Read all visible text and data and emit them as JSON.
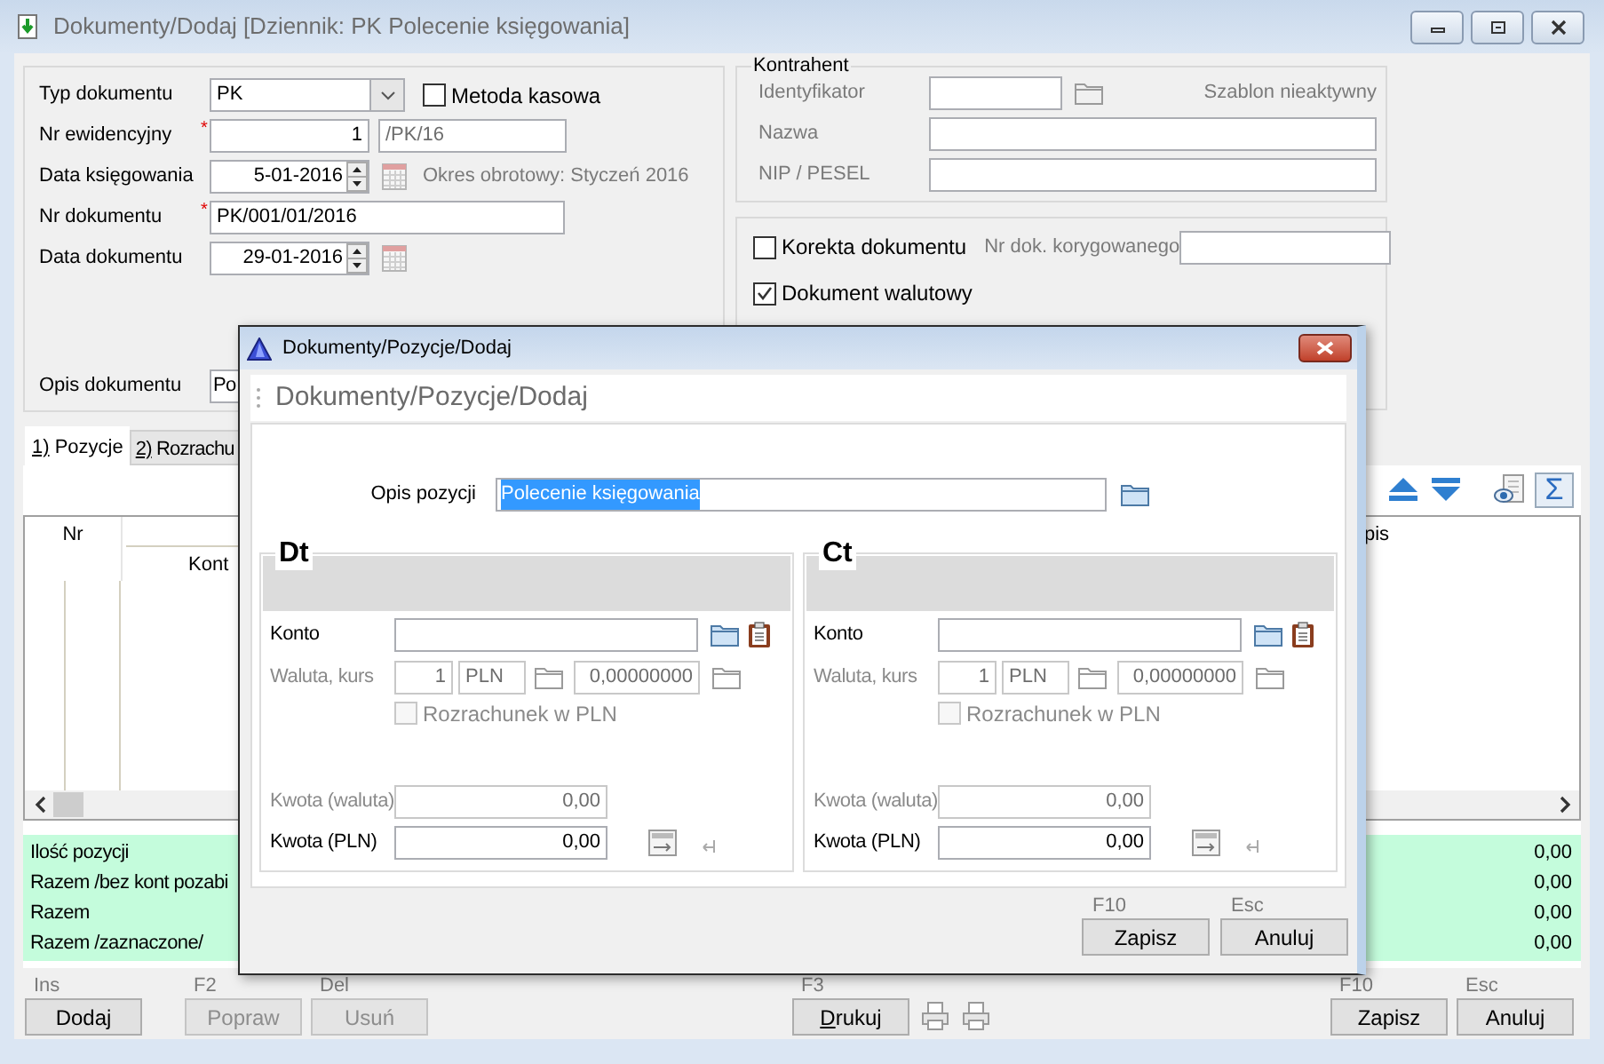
{
  "window": {
    "title": "Dokumenty/Dodaj [Dziennik: PK  Polecenie księgowania]"
  },
  "document": {
    "fields": [
      {
        "kind": "combo",
        "label": "Typ dokumentu",
        "value": "PK",
        "checkbox": {
          "label": "Metoda kasowa",
          "checked": false
        }
      },
      {
        "kind": "number",
        "label": "Nr ewidencyjny",
        "required_mark": "*",
        "value": "1",
        "suffix": "/PK/16"
      },
      {
        "kind": "date",
        "label": "Data księgowania",
        "value": "5-01-2016",
        "note": "Okres obrotowy: Styczeń 2016"
      },
      {
        "kind": "text",
        "label": "Nr dokumentu",
        "required_mark": "*",
        "value": "PK/001/01/2016"
      },
      {
        "kind": "date",
        "label": "Data dokumentu",
        "value": "29-01-2016"
      }
    ],
    "description": {
      "label": "Opis dokumentu",
      "value": "Po"
    }
  },
  "contractor": {
    "title": "Kontrahent",
    "fields": [
      {
        "kind": "lookup",
        "label": "Identyfikator",
        "status": "Szablon nieaktywny"
      },
      {
        "kind": "text",
        "label": "Nazwa"
      },
      {
        "kind": "text",
        "label": "NIP / PESEL"
      }
    ]
  },
  "options": {
    "correction": {
      "label": "Korekta dokumentu",
      "checked": false
    },
    "corrected_number_label": "Nr dok. korygowanego",
    "currency": {
      "label": "Dokument walutowy",
      "checked": true
    }
  },
  "tabs": [
    {
      "label": "1) Pozycje",
      "selected": true,
      "underline_first": true
    },
    {
      "label": "2) Rozrachu",
      "selected": false,
      "underline_first": true
    }
  ],
  "toolbar": {
    "sum_button": "Σ"
  },
  "grid": {
    "columns": [
      "Nr",
      "Kont",
      "pis"
    ]
  },
  "summary": {
    "rows": [
      {
        "label": "Ilość pozycji",
        "value": "0,00"
      },
      {
        "label": "Razem /bez kont pozabi",
        "value": "0,00"
      },
      {
        "label": "Razem",
        "value": "0,00"
      },
      {
        "label": "Razem /zaznaczone/",
        "value": "0,00"
      }
    ]
  },
  "button_groups": [
    [
      {
        "shortcut": "Ins",
        "label": "Dodaj",
        "disabled": false
      },
      {
        "shortcut": "F2",
        "label": "Popraw",
        "disabled": true
      },
      {
        "shortcut": "Del",
        "label": "Usuń",
        "disabled": true
      }
    ],
    [
      {
        "shortcut": "F3",
        "label": "Drukuj",
        "disabled": false,
        "underline_first": true
      }
    ],
    [
      {
        "shortcut": "F10",
        "label": "Zapisz",
        "disabled": false
      },
      {
        "shortcut": "Esc",
        "label": "Anuluj",
        "disabled": false
      }
    ]
  ],
  "dialog": {
    "title": "Dokumenty/Pozycje/Dodaj",
    "heading": "Dokumenty/Pozycje/Dodaj",
    "description": {
      "label": "Opis pozycji",
      "value": "Polecenie księgowania"
    },
    "sides": [
      {
        "title": "Dt",
        "account_label": "Konto",
        "currency_label": "Waluta, kurs",
        "multiplier": "1",
        "currency": "PLN",
        "rate": "0,00000000",
        "settle": {
          "label": "Rozrachunek w PLN",
          "checked": false,
          "disabled": true
        },
        "amount_currency_label": "Kwota (waluta)",
        "amount_currency": "0,00",
        "amount_pln_label": "Kwota (PLN)",
        "amount_pln": "0,00"
      },
      {
        "title": "Ct",
        "account_label": "Konto",
        "currency_label": "Waluta, kurs",
        "multiplier": "1",
        "currency": "PLN",
        "rate": "0,00000000",
        "settle": {
          "label": "Rozrachunek w PLN",
          "checked": false,
          "disabled": true
        },
        "amount_currency_label": "Kwota (waluta)",
        "amount_currency": "0,00",
        "amount_pln_label": "Kwota (PLN)",
        "amount_pln": "0,00"
      }
    ],
    "buttons": [
      {
        "shortcut": "F10",
        "label": "Zapisz"
      },
      {
        "shortcut": "Esc",
        "label": "Anuluj"
      }
    ]
  }
}
